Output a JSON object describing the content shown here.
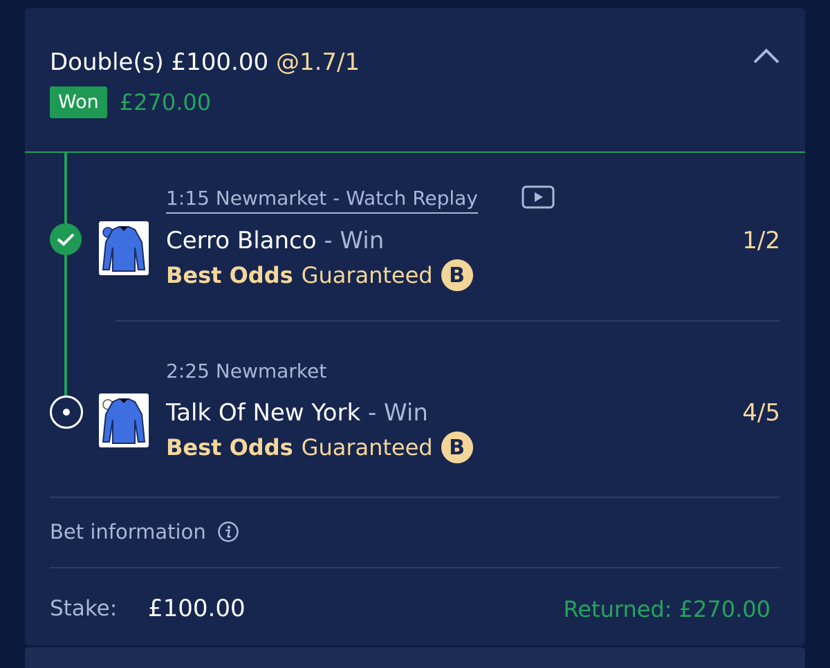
{
  "bet": {
    "title": "Double(s) £100.00",
    "odds": "@1.7/1",
    "status_badge": "Won",
    "won_amount": "£270.00",
    "collapse_icon": "chevron-up-icon"
  },
  "legs": [
    {
      "race": "1:15 Newmarket - Watch Replay",
      "replay_icon": "play-video-icon",
      "horse": "Cerro Blanco",
      "market": " - Win",
      "price": "1/2",
      "bog_strong": "Best Odds",
      "bog_rest": "Guaranteed",
      "bog_badge": "B",
      "result_state": "won",
      "silk_color": "#3d6fe0"
    },
    {
      "race": "2:25 Newmarket",
      "horse": "Talk Of New York",
      "market": " - Win",
      "price": "4/5",
      "bog_strong": "Best Odds",
      "bog_rest": "Guaranteed",
      "bog_badge": "B",
      "result_state": "pending",
      "silk_color": "#3d6fe0"
    }
  ],
  "bet_information": {
    "label": "Bet information",
    "icon": "info-icon"
  },
  "footer": {
    "stake_label": "Stake:",
    "stake_value": "£100.00",
    "returned": "Returned: £270.00"
  },
  "colors": {
    "background": "#0b1a3c",
    "card": "#17264f",
    "won_green": "#1f9a55",
    "odds_gold": "#f5d79a"
  }
}
